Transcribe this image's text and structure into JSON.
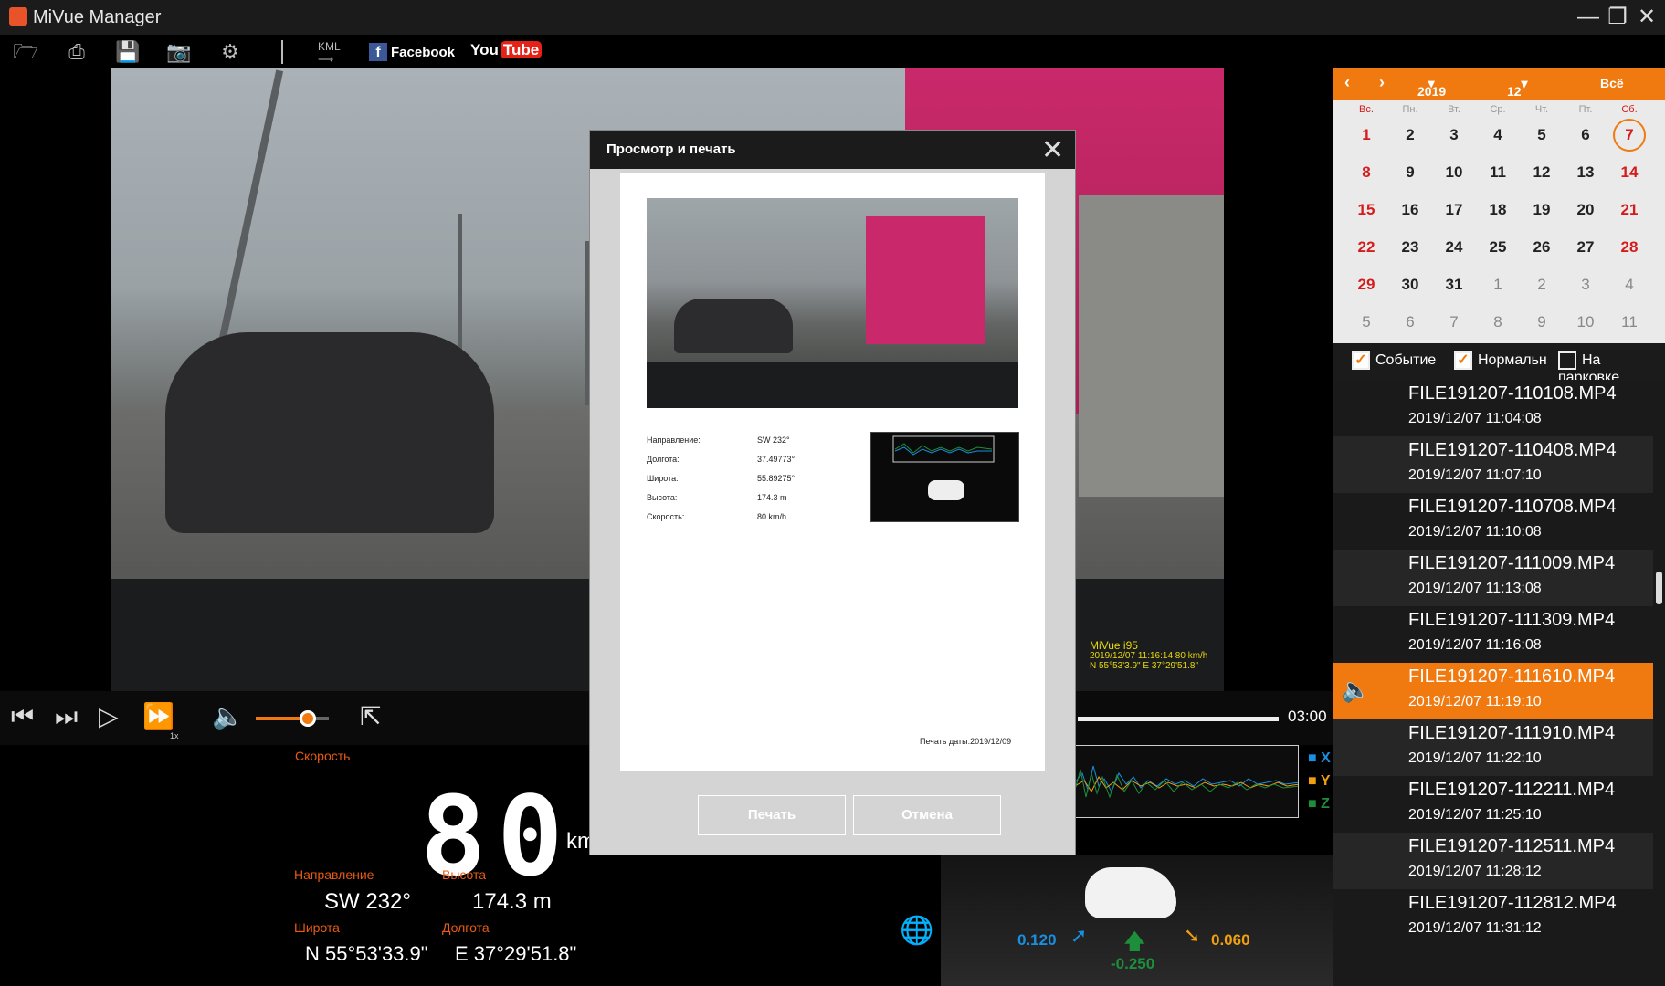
{
  "app": {
    "title": "MiVue Manager"
  },
  "toolbar": {
    "kml": "KML",
    "facebook": "Facebook",
    "youtube_you": "You",
    "youtube_tube": "Tube"
  },
  "video_overlay": {
    "model": "MiVue i95",
    "line1": "2019/12/07 11:16:14 80 km/h",
    "line2": "N 55°53'3.9\" E 37°29'51.8\""
  },
  "player": {
    "speed_mult": "1x",
    "time": "03:00"
  },
  "info": {
    "speed_label": "Скорость",
    "speed": "80",
    "speed_unit": "km/h",
    "direction_label": "Направление",
    "direction": "SW 232°",
    "altitude_label": "Высота",
    "altitude": "174.3  m",
    "latitude_label": "Широта",
    "latitude": "N 55°53'33.9\"",
    "longitude_label": "Долгота",
    "longitude": "E 37°29'51.8\""
  },
  "gsensor": {
    "x_label": "X",
    "y_label": "Y",
    "z_label": "Z",
    "x_val": "0.120",
    "z_val": "-0.250",
    "y_val": "0.060",
    "colors": {
      "x": "#1a8fdf",
      "y": "#f0a010",
      "z": "#1d8f3a"
    }
  },
  "calendar": {
    "year": "2019",
    "month": "12",
    "all": "Всё",
    "weekdays": [
      "Вс.",
      "Пн.",
      "Вт.",
      "Ср.",
      "Чт.",
      "Пт.",
      "Сб."
    ],
    "weeks": [
      [
        "1",
        "2",
        "3",
        "4",
        "5",
        "6",
        "7"
      ],
      [
        "8",
        "9",
        "10",
        "11",
        "12",
        "13",
        "14"
      ],
      [
        "15",
        "16",
        "17",
        "18",
        "19",
        "20",
        "21"
      ],
      [
        "22",
        "23",
        "24",
        "25",
        "26",
        "27",
        "28"
      ],
      [
        "29",
        "30",
        "31",
        "1",
        "2",
        "3",
        "4"
      ],
      [
        "5",
        "6",
        "7",
        "8",
        "9",
        "10",
        "11"
      ]
    ],
    "selected_day": "7"
  },
  "filters": {
    "event": "Событие",
    "normal": "Нормальн",
    "parking": "На парковке"
  },
  "files": [
    {
      "name": "FILE191207-110108.MP4",
      "date": "2019/12/07   11:04:08"
    },
    {
      "name": "FILE191207-110408.MP4",
      "date": "2019/12/07   11:07:10"
    },
    {
      "name": "FILE191207-110708.MP4",
      "date": "2019/12/07   11:10:08"
    },
    {
      "name": "FILE191207-111009.MP4",
      "date": "2019/12/07   11:13:08"
    },
    {
      "name": "FILE191207-111309.MP4",
      "date": "2019/12/07   11:16:08"
    },
    {
      "name": "FILE191207-111610.MP4",
      "date": "2019/12/07   11:19:10"
    },
    {
      "name": "FILE191207-111910.MP4",
      "date": "2019/12/07   11:22:10"
    },
    {
      "name": "FILE191207-112211.MP4",
      "date": "2019/12/07   11:25:10"
    },
    {
      "name": "FILE191207-112511.MP4",
      "date": "2019/12/07   11:28:12"
    },
    {
      "name": "FILE191207-112812.MP4",
      "date": "2019/12/07   11:31:12"
    }
  ],
  "modal": {
    "title": "Просмотр и печать",
    "direction_label": "Направление:",
    "direction": "SW 232°",
    "longitude_label": "Долгота:",
    "longitude": "37.49773°",
    "latitude_label": "Широта:",
    "latitude": "55.89275°",
    "altitude_label": "Высота:",
    "altitude": "174.3  m",
    "speed_label": "Скорость:",
    "speed": "80  km/h",
    "print_date": "Печать даты:2019/12/09",
    "print_button": "Печать",
    "cancel_button": "Отмена"
  }
}
